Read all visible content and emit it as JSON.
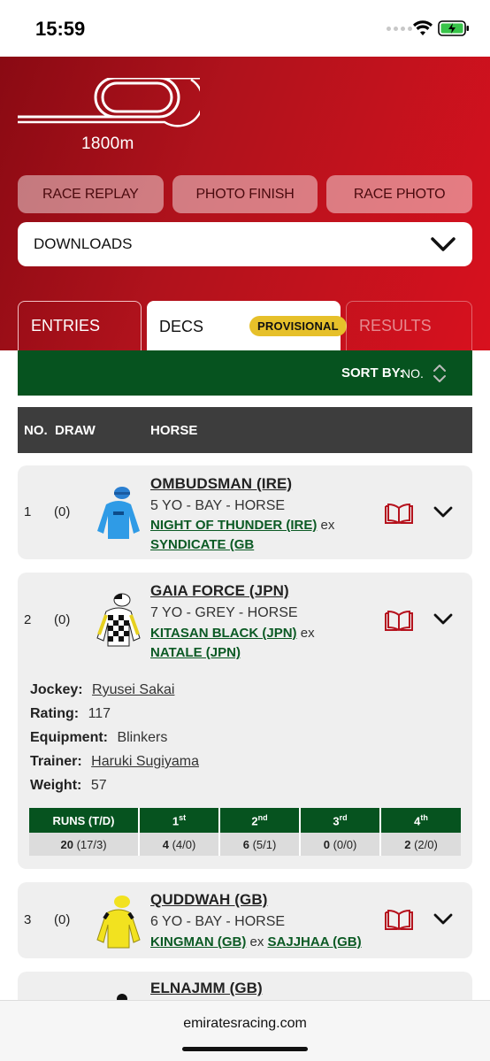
{
  "status_bar": {
    "time": "15:59"
  },
  "race": {
    "distance": "1800m"
  },
  "buttons": {
    "replay": "RACE REPLAY",
    "photo_finish": "PHOTO FINISH",
    "race_photo": "RACE PHOTO"
  },
  "downloads": {
    "label": "DOWNLOADS"
  },
  "tabs": {
    "entries": "ENTRIES",
    "decs": "DECS",
    "badge": "PROVISIONAL",
    "results": "RESULTS"
  },
  "sort": {
    "label": "SORT BY:",
    "value": "NO."
  },
  "columns": {
    "no": "NO.",
    "draw": "DRAW",
    "horse": "HORSE"
  },
  "runners": [
    {
      "no": "1",
      "draw": "(0)",
      "name": "OMBUDSMAN (IRE)",
      "desc": "5 YO - BAY - HORSE",
      "sire": "NIGHT OF THUNDER (IRE)",
      "ex": "ex",
      "dam": "SYNDICATE (GB"
    },
    {
      "no": "2",
      "draw": "(0)",
      "name": "GAIA FORCE (JPN)",
      "desc": "7 YO - GREY - HORSE",
      "sire": "KITASAN BLACK (JPN)",
      "ex": "ex",
      "dam": "NATALE (JPN)"
    },
    {
      "no": "3",
      "draw": "(0)",
      "name": "QUDDWAH (GB)",
      "desc": "6 YO - BAY - HORSE",
      "sire": "KINGMAN (GB)",
      "ex": "ex",
      "dam": "SAJJHAA (GB)"
    },
    {
      "name": "ELNAJMM (GB)"
    }
  ],
  "details": {
    "jockey_label": "Jockey:",
    "jockey": "Ryusei Sakai",
    "rating_label": "Rating:",
    "rating": "117",
    "equipment_label": "Equipment:",
    "equipment": "Blinkers",
    "trainer_label": "Trainer:",
    "trainer": "Haruki Sugiyama",
    "weight_label": "Weight:",
    "weight": "57",
    "stats_headers": {
      "runs": "RUNS (T/D)",
      "first": "1",
      "first_sup": "st",
      "second": "2",
      "second_sup": "nd",
      "third": "3",
      "third_sup": "rd",
      "fourth": "4",
      "fourth_sup": "th"
    },
    "stats": {
      "runs": "20",
      "runs_sub": "(17/3)",
      "first": "4",
      "first_sub": "(4/0)",
      "second": "6",
      "second_sub": "(5/1)",
      "third": "0",
      "third_sub": "(0/0)",
      "fourth": "2",
      "fourth_sub": "(2/0)"
    }
  },
  "footer": {
    "url": "emiratesracing.com"
  },
  "colors": {
    "header_red": "#c8101c",
    "green": "#06531f",
    "badge": "#e6c02a",
    "column_header": "#3d3d3d"
  }
}
